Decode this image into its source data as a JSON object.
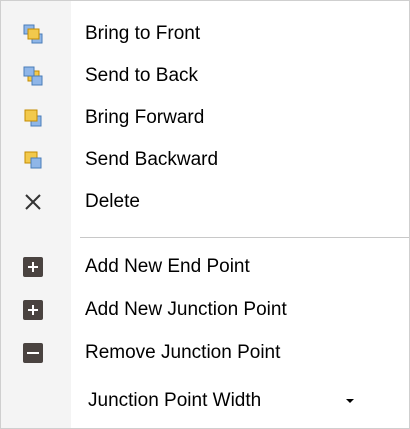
{
  "menu": {
    "items": [
      {
        "label": "Bring to Front",
        "icon": "bring-to-front-icon"
      },
      {
        "label": "Send to Back",
        "icon": "send-to-back-icon"
      },
      {
        "label": "Bring Forward",
        "icon": "bring-forward-icon"
      },
      {
        "label": "Send Backward",
        "icon": "send-backward-icon"
      },
      {
        "label": "Delete",
        "icon": "delete-icon"
      },
      {
        "label": "Add New End Point",
        "icon": "plus-icon"
      },
      {
        "label": "Add New Junction Point",
        "icon": "plus-icon"
      },
      {
        "label": "Remove Junction Point",
        "icon": "minus-icon"
      }
    ],
    "combo": {
      "label": "Junction Point Width",
      "icon": "chevron-down-icon"
    }
  },
  "colors": {
    "icon_yellow": "#f2c94c",
    "icon_yellow_dark": "#c48b00",
    "icon_blue": "#8fb6e8",
    "icon_blue_dark": "#4a7db8",
    "icon_dark_square": "#4a4340",
    "separator": "#c8c8c8",
    "gutter": "#f4f4f4"
  }
}
